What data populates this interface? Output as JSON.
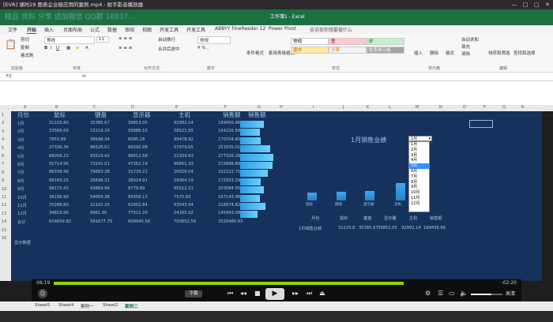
{
  "window": {
    "title": "[EVR] 课时29 图表企业级应用的案例.mp4 - 射手影音播放器",
    "excel_title": "工作簿1 - Excel",
    "overlay_text": "精品 资料 分享 请加微信 QQ群 18837..."
  },
  "ribbon": {
    "tabs": [
      "文件",
      "开始",
      "插入",
      "页面布局",
      "公式",
      "数据",
      "审阅",
      "视图",
      "开发工具",
      "开发工具",
      "ABBYY FineReader 12",
      "Power Pivot",
      "告诉我你想要做什么"
    ],
    "clipboard": [
      "剪切",
      "复制",
      "格式刷"
    ],
    "groups": [
      "剪贴板",
      "字体",
      "对齐方式",
      "数字",
      "样式",
      "单元格",
      "编辑"
    ],
    "font_name": "等线",
    "font_size": "11",
    "wrap": "自动换行",
    "merge": "合并后居中",
    "number_format": "常规",
    "cond_format": "条件格式",
    "table_format": "套用表格格式",
    "styles": [
      {
        "label": "常规",
        "bg": "#ffffff",
        "fg": "#000000"
      },
      {
        "label": "差",
        "bg": "#ffc7ce",
        "fg": "#9c0006"
      },
      {
        "label": "好",
        "bg": "#c6efce",
        "fg": "#006100"
      },
      {
        "label": "适中",
        "bg": "#ffeb9c",
        "fg": "#9c5700"
      },
      {
        "label": "计算",
        "bg": "#f2f2f2",
        "fg": "#fa7d00"
      },
      {
        "label": "检查单元格",
        "bg": "#a5a5a5",
        "fg": "#ffffff"
      }
    ],
    "cells_group": [
      "插入",
      "删除",
      "格式"
    ],
    "editing": [
      "自动求和",
      "填充",
      "清除",
      "排序和筛选",
      "查找和选择"
    ]
  },
  "formula_bar": {
    "name_box": "F2",
    "fx": "fx"
  },
  "columns": [
    "A",
    "B",
    "C",
    "D",
    "E",
    "F",
    "G",
    "H",
    "I",
    "J",
    "K",
    "L",
    "M",
    "N",
    "O",
    "P",
    "Q",
    "R"
  ],
  "rows": [
    "1",
    "2",
    "3",
    "4",
    "5",
    "6",
    "7",
    "8",
    "9",
    "10",
    "11",
    "12",
    "13",
    "14",
    "15",
    "16"
  ],
  "table": {
    "headers": [
      "月份",
      "鼠标",
      "键盘",
      "显示器",
      "主机",
      "销售额",
      "销售额"
    ],
    "rows": [
      [
        "1月",
        "31225.80",
        "35385.67",
        "39853.05",
        "92992.14",
        "199456.66"
      ],
      [
        "2月",
        "33589.69",
        "15219.29",
        "56886.53",
        "58521.95",
        "164216.58"
      ],
      [
        "3月",
        "7853.89",
        "38648.34",
        "6095.18",
        "99478.92",
        "170704.80"
      ],
      [
        "4月",
        "37336.36",
        "86526.61",
        "84292.98",
        "57479.65",
        "251635.01"
      ],
      [
        "5月",
        "68058.23",
        "93519.42",
        "96612.58",
        "21939.83",
        "277326.28"
      ],
      [
        "6月",
        "55714.96",
        "73241.01",
        "47262.19",
        "96851.33",
        "272888.88"
      ],
      [
        "7月",
        "86938.48",
        "79683.38",
        "31739.21",
        "26026.04",
        "232222.75"
      ],
      [
        "8月",
        "89169.25",
        "26696.31",
        "28024.91",
        "18964.19",
        "172553.29"
      ],
      [
        "9月",
        "98172.43",
        "43869.96",
        "8779.89",
        "65512.21",
        "203084.55"
      ],
      [
        "10月",
        "36196.99",
        "54009.36",
        "89356.13",
        "7575.83",
        "167143.98"
      ],
      [
        "11月",
        "70286.80",
        "21102.25",
        "61602.84",
        "63543.94",
        "216074.82"
      ],
      [
        "12月",
        "34818.96",
        "9981.90",
        "77521.20",
        "24165.92",
        "145493.08"
      ],
      [
        "合计",
        "616609.82",
        "591677.79",
        "609945.56",
        "703652.59",
        "2520480.93"
      ]
    ],
    "sales_fraction": [
      0.71,
      0.59,
      0.61,
      0.9,
      0.99,
      0.97,
      0.83,
      0.62,
      0.72,
      0.6,
      0.77,
      0.52
    ],
    "note": "显示数据"
  },
  "chart": {
    "title": "1月销售业绩",
    "selector_value": "1月",
    "options": [
      "1月",
      "2月",
      "3月",
      "4月",
      "5月",
      "6月",
      "7月",
      "8月",
      "9月",
      "10月",
      "11月",
      "12月"
    ],
    "selected_index": 4,
    "bar_labels": [
      "鼠标",
      "键盘",
      "显示器",
      "主机"
    ],
    "bar_values": [
      31225.8,
      35385.67,
      39853.05,
      92992.14
    ],
    "summary_headers": [
      "月份",
      "鼠标",
      "键盘",
      "显示器",
      "主机",
      "销售额"
    ],
    "summary_row": [
      "1月销售业绩",
      "31225.8",
      "35385.67",
      "39853.05",
      "92992.14",
      "199456.66"
    ]
  },
  "player": {
    "time_current": "08:19",
    "time_remaining": "-02:20",
    "progress": 0.8,
    "subtitle_button": "字幕",
    "quality": "高清"
  },
  "sheet_tabs": [
    "Sheet5",
    "Sheet4",
    "案例一",
    "Sheet2",
    "案例二"
  ],
  "active_sheet": 4
}
